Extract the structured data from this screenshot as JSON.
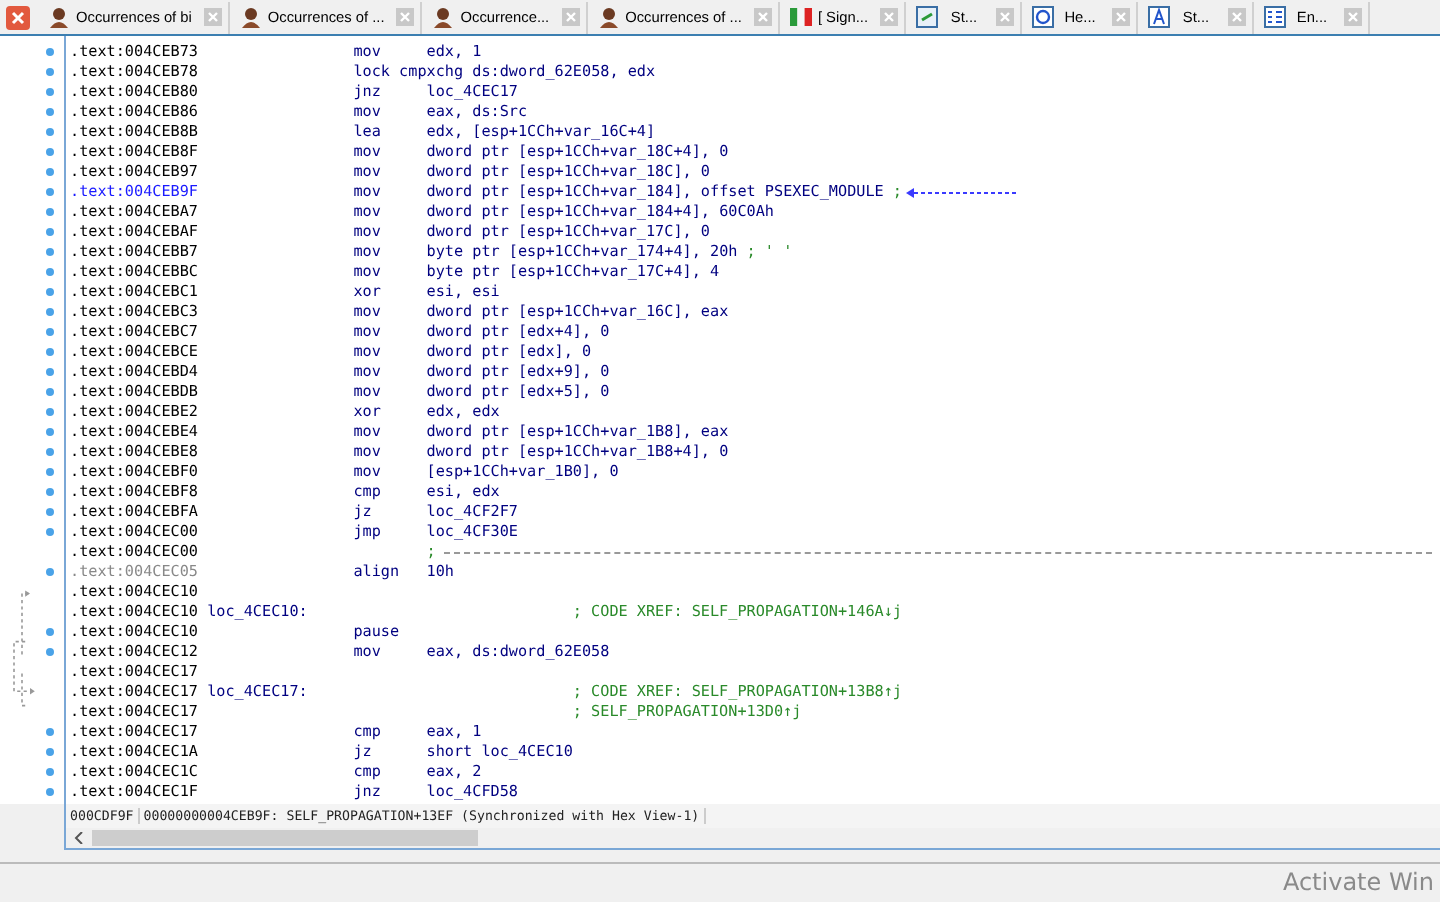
{
  "tabs": [
    {
      "label": "Occurrences of bi",
      "kind": "person",
      "selected": false
    },
    {
      "label": "Occurrences of ...",
      "kind": "person",
      "selected": false
    },
    {
      "label": "Occurrence...",
      "kind": "person",
      "selected": false
    },
    {
      "label": "Occurrences of ...",
      "kind": "person",
      "selected": false
    },
    {
      "label": "[ Sign...",
      "kind": "flag",
      "selected": false
    },
    {
      "label": "St...",
      "kind": "strings",
      "selected": false
    },
    {
      "label": "He...",
      "kind": "hex",
      "selected": false
    },
    {
      "label": "St...",
      "kind": "letter",
      "selected": false
    },
    {
      "label": "En...",
      "kind": "grid",
      "selected": false
    }
  ],
  "listing": {
    "rows": [
      {
        "addr": ".text:004CEB73",
        "label": "",
        "mnem": "mov",
        "ops": "edx, 1",
        "comment": "",
        "kind": "normal",
        "dot": true
      },
      {
        "addr": ".text:004CEB78",
        "label": "",
        "mnem": "lock cmpxchg",
        "ops": "ds:dword_62E058, edx",
        "comment": "",
        "kind": "normal",
        "dot": true
      },
      {
        "addr": ".text:004CEB80",
        "label": "",
        "mnem": "jnz",
        "ops": "loc_4CEC17",
        "comment": "",
        "kind": "normal",
        "dot": true
      },
      {
        "addr": ".text:004CEB86",
        "label": "",
        "mnem": "mov",
        "ops": "eax, ds:Src",
        "comment": "",
        "kind": "normal",
        "dot": true
      },
      {
        "addr": ".text:004CEB8B",
        "label": "",
        "mnem": "lea",
        "ops": "edx, [esp+1CCh+var_16C+4]",
        "comment": "",
        "kind": "normal",
        "dot": true
      },
      {
        "addr": ".text:004CEB8F",
        "label": "",
        "mnem": "mov",
        "ops": "dword ptr [esp+1CCh+var_18C+4], 0",
        "comment": "",
        "kind": "normal",
        "dot": true
      },
      {
        "addr": ".text:004CEB97",
        "label": "",
        "mnem": "mov",
        "ops": "dword ptr [esp+1CCh+var_18C], 0",
        "comment": "",
        "kind": "normal",
        "dot": true
      },
      {
        "addr": ".text:004CEB9F",
        "label": "",
        "mnem": "mov",
        "ops": "dword ptr [esp+1CCh+var_184], offset PSEXEC_MODULE",
        "comment": ";",
        "kind": "current",
        "dot": true
      },
      {
        "addr": ".text:004CEBA7",
        "label": "",
        "mnem": "mov",
        "ops": "dword ptr [esp+1CCh+var_184+4], 60C0Ah",
        "comment": "",
        "kind": "normal",
        "dot": true
      },
      {
        "addr": ".text:004CEBAF",
        "label": "",
        "mnem": "mov",
        "ops": "dword ptr [esp+1CCh+var_17C], 0",
        "comment": "",
        "kind": "normal",
        "dot": true
      },
      {
        "addr": ".text:004CEBB7",
        "label": "",
        "mnem": "mov",
        "ops": "byte ptr [esp+1CCh+var_174+4], 20h",
        "comment": "; ' '",
        "kind": "normal",
        "dot": true
      },
      {
        "addr": ".text:004CEBBC",
        "label": "",
        "mnem": "mov",
        "ops": "byte ptr [esp+1CCh+var_17C+4], 4",
        "comment": "",
        "kind": "normal",
        "dot": true
      },
      {
        "addr": ".text:004CEBC1",
        "label": "",
        "mnem": "xor",
        "ops": "esi, esi",
        "comment": "",
        "kind": "normal",
        "dot": true
      },
      {
        "addr": ".text:004CEBC3",
        "label": "",
        "mnem": "mov",
        "ops": "dword ptr [esp+1CCh+var_16C], eax",
        "comment": "",
        "kind": "normal",
        "dot": true
      },
      {
        "addr": ".text:004CEBC7",
        "label": "",
        "mnem": "mov",
        "ops": "dword ptr [edx+4], 0",
        "comment": "",
        "kind": "normal",
        "dot": true
      },
      {
        "addr": ".text:004CEBCE",
        "label": "",
        "mnem": "mov",
        "ops": "dword ptr [edx], 0",
        "comment": "",
        "kind": "normal",
        "dot": true
      },
      {
        "addr": ".text:004CEBD4",
        "label": "",
        "mnem": "mov",
        "ops": "dword ptr [edx+9], 0",
        "comment": "",
        "kind": "normal",
        "dot": true
      },
      {
        "addr": ".text:004CEBDB",
        "label": "",
        "mnem": "mov",
        "ops": "dword ptr [edx+5], 0",
        "comment": "",
        "kind": "normal",
        "dot": true
      },
      {
        "addr": ".text:004CEBE2",
        "label": "",
        "mnem": "xor",
        "ops": "edx, edx",
        "comment": "",
        "kind": "normal",
        "dot": true
      },
      {
        "addr": ".text:004CEBE4",
        "label": "",
        "mnem": "mov",
        "ops": "dword ptr [esp+1CCh+var_1B8], eax",
        "comment": "",
        "kind": "normal",
        "dot": true
      },
      {
        "addr": ".text:004CEBE8",
        "label": "",
        "mnem": "mov",
        "ops": "dword ptr [esp+1CCh+var_1B8+4], 0",
        "comment": "",
        "kind": "normal",
        "dot": true
      },
      {
        "addr": ".text:004CEBF0",
        "label": "",
        "mnem": "mov",
        "ops": "[esp+1CCh+var_1B0], 0",
        "comment": "",
        "kind": "normal",
        "dot": true
      },
      {
        "addr": ".text:004CEBF8",
        "label": "",
        "mnem": "cmp",
        "ops": "esi, edx",
        "comment": "",
        "kind": "normal",
        "dot": true
      },
      {
        "addr": ".text:004CEBFA",
        "label": "",
        "mnem": "jz",
        "ops": "loc_4CF2F7",
        "comment": "",
        "kind": "normal",
        "dot": true
      },
      {
        "addr": ".text:004CEC00",
        "label": "",
        "mnem": "jmp",
        "ops": "loc_4CF30E",
        "comment": "",
        "kind": "normal",
        "dot": true
      },
      {
        "addr": ".text:004CEC00",
        "label": "",
        "mnem": "",
        "ops": "",
        "comment": ";",
        "kind": "separator",
        "dot": false
      },
      {
        "addr": ".text:004CEC05",
        "label": "",
        "mnem": "align",
        "ops": "10h",
        "comment": "",
        "kind": "dim",
        "dot": true
      },
      {
        "addr": ".text:004CEC10",
        "label": "",
        "mnem": "",
        "ops": "",
        "comment": "",
        "kind": "normal",
        "dot": false
      },
      {
        "addr": ".text:004CEC10",
        "label": "loc_4CEC10:",
        "mnem": "",
        "ops": "",
        "comment": "; CODE XREF: SELF_PROPAGATION+146A↓j",
        "kind": "normal",
        "dot": false
      },
      {
        "addr": ".text:004CEC10",
        "label": "",
        "mnem": "pause",
        "ops": "",
        "comment": "",
        "kind": "normal",
        "dot": true
      },
      {
        "addr": ".text:004CEC12",
        "label": "",
        "mnem": "mov",
        "ops": "eax, ds:dword_62E058",
        "comment": "",
        "kind": "normal",
        "dot": true
      },
      {
        "addr": ".text:004CEC17",
        "label": "",
        "mnem": "",
        "ops": "",
        "comment": "",
        "kind": "normal",
        "dot": false
      },
      {
        "addr": ".text:004CEC17",
        "label": "loc_4CEC17:",
        "mnem": "",
        "ops": "",
        "comment": "; CODE XREF: SELF_PROPAGATION+13B8↑j",
        "kind": "normal",
        "dot": false
      },
      {
        "addr": ".text:004CEC17",
        "label": "",
        "mnem": "",
        "ops": "",
        "comment": "; SELF_PROPAGATION+13D0↑j",
        "kind": "normal",
        "dot": false
      },
      {
        "addr": ".text:004CEC17",
        "label": "",
        "mnem": "cmp",
        "ops": "eax, 1",
        "comment": "",
        "kind": "normal",
        "dot": true
      },
      {
        "addr": ".text:004CEC1A",
        "label": "",
        "mnem": "jz",
        "ops": "short loc_4CEC10",
        "comment": "",
        "kind": "normal",
        "dot": true
      },
      {
        "addr": ".text:004CEC1C",
        "label": "",
        "mnem": "cmp",
        "ops": "eax, 2",
        "comment": "",
        "kind": "normal",
        "dot": true
      },
      {
        "addr": ".text:004CEC1F",
        "label": "",
        "mnem": "jnz",
        "ops": "loc_4CFD58",
        "comment": "",
        "kind": "normal",
        "dot": true
      }
    ]
  },
  "status_bar": {
    "offset": "000CDF9F",
    "location": "00000000004CEB9F: SELF_PROPAGATION+13EF (Synchronized with Hex View-1)"
  },
  "os_notice": "Activate Win"
}
